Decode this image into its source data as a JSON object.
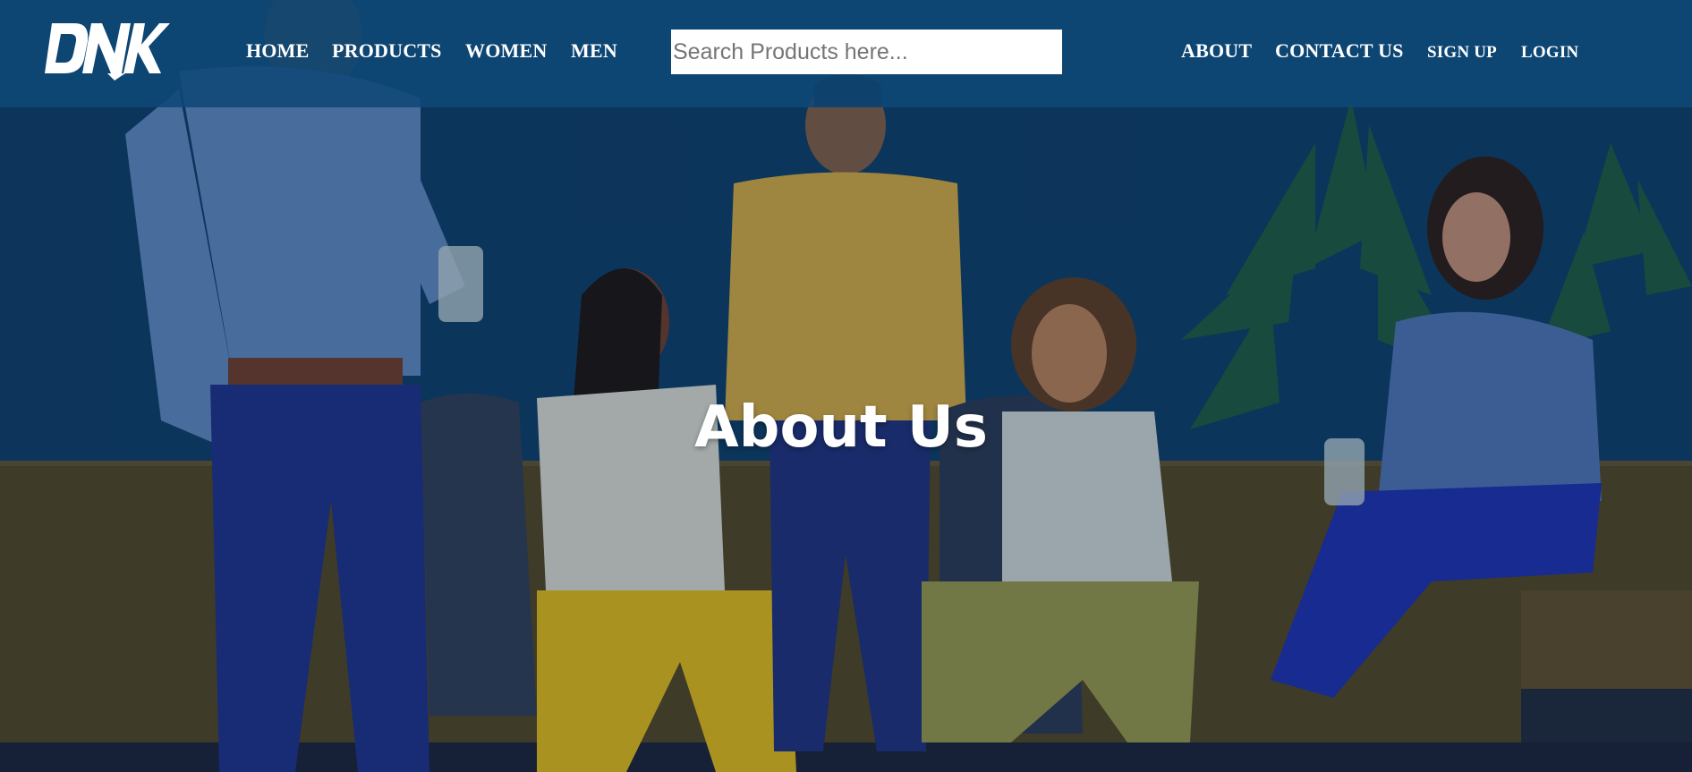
{
  "brand": {
    "logo_text": "DNK"
  },
  "nav": {
    "left": [
      {
        "label": "HOME"
      },
      {
        "label": "PRODUCTS"
      },
      {
        "label": "WOMEN"
      },
      {
        "label": "MEN"
      }
    ],
    "right": [
      {
        "label": "ABOUT"
      },
      {
        "label": "CONTACT US"
      },
      {
        "label": "SIGN UP"
      },
      {
        "label": "LOGIN"
      }
    ]
  },
  "search": {
    "placeholder": "Search Products here...",
    "value": ""
  },
  "hero": {
    "title": "About Us"
  },
  "colors": {
    "navbar": "#0e4876",
    "hero_wall": "#0d3a60",
    "text": "#ffffff"
  }
}
